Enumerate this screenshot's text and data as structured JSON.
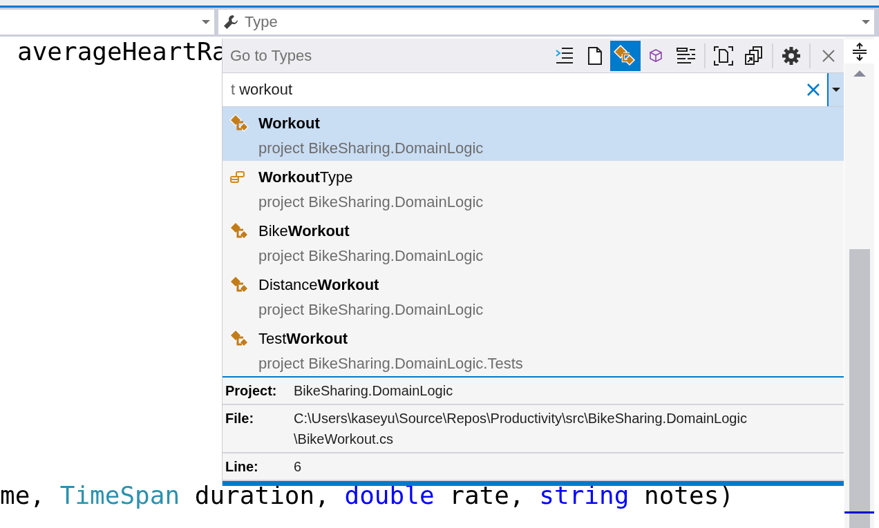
{
  "navigation_bar": {
    "member_dropdown": {
      "value": "Type"
    }
  },
  "editor": {
    "code_lines": [
      {
        "tokens": [
          {
            "text": "averageHeartRa",
            "kind": "identifier"
          }
        ]
      },
      {
        "tokens": [
          {
            "text": "me, ",
            "kind": "identifier"
          },
          {
            "text": "TimeSpan",
            "kind": "type"
          },
          {
            "text": " duration, ",
            "kind": "identifier"
          },
          {
            "text": "double",
            "kind": "keyword"
          },
          {
            "text": " rate, ",
            "kind": "identifier"
          },
          {
            "text": "string",
            "kind": "keyword"
          },
          {
            "text": " notes)",
            "kind": "identifier"
          }
        ]
      }
    ]
  },
  "go_to_popup": {
    "title": "Go to Types",
    "filters": [
      {
        "kind": "members",
        "selected": false
      },
      {
        "kind": "files",
        "selected": false
      },
      {
        "kind": "types",
        "selected": true
      },
      {
        "kind": "symbols",
        "selected": false
      },
      {
        "kind": "text",
        "selected": false
      }
    ],
    "scopes": [
      {
        "kind": "current-document",
        "selected": false
      },
      {
        "kind": "all-documents",
        "selected": false
      }
    ],
    "search": {
      "filter_prefix": "t",
      "query": "workout"
    },
    "results": [
      {
        "kind": "class",
        "name": "**Workout**",
        "project": "project BikeSharing.DomainLogic",
        "selected": true
      },
      {
        "kind": "enum",
        "name": "**Workout**Type",
        "project": "project BikeSharing.DomainLogic",
        "selected": false
      },
      {
        "kind": "class",
        "name": "Bike**Workout**",
        "project": "project BikeSharing.DomainLogic",
        "selected": false
      },
      {
        "kind": "class",
        "name": "Distance**Workout**",
        "project": "project BikeSharing.DomainLogic",
        "selected": false
      },
      {
        "kind": "class",
        "name": "Test**Workout**",
        "project": "project BikeSharing.DomainLogic.Tests",
        "selected": false
      }
    ],
    "details": [
      {
        "label": "Project:",
        "value": "BikeSharing.DomainLogic"
      },
      {
        "label": "File:",
        "value": "C:\\Users\\kaseyu\\Source\\Repos\\Productivity\\src\\BikeSharing.DomainLogic\\BikeWorkout.cs"
      },
      {
        "label": "Line:",
        "value": "6"
      }
    ]
  }
}
